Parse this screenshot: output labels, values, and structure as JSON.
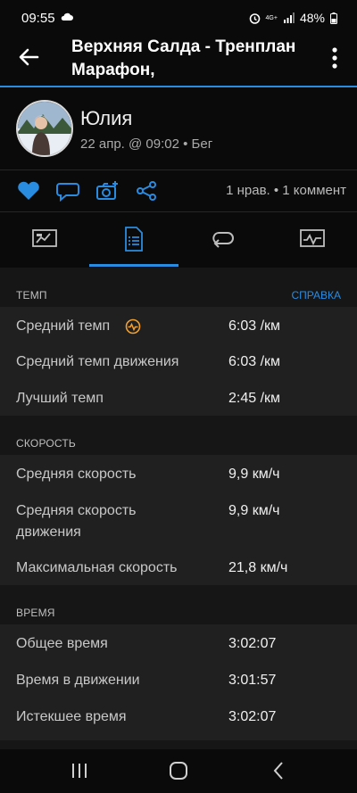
{
  "status_bar": {
    "time": "09:55",
    "network": "4G+",
    "battery": "48%"
  },
  "app_bar": {
    "title": "Верхняя Салда - Трenплан Марафон,"
  },
  "profile": {
    "name": "Юлия",
    "meta": "22 апр. @ 09:02 • Бег"
  },
  "social": {
    "counts": "1 нрав. • 1 коммент"
  },
  "sections": {
    "pace": {
      "title": "ТЕМП",
      "help": "СПРАВКА",
      "rows": [
        {
          "label": "Средний темп",
          "value": "6:03 /км"
        },
        {
          "label": "Средний темп движения",
          "value": "6:03 /км"
        },
        {
          "label": "Лучший темп",
          "value": "2:45 /км"
        }
      ]
    },
    "speed": {
      "title": "СКОРОСТЬ",
      "rows": [
        {
          "label": "Средняя скорость",
          "value": "9,9 км/ч"
        },
        {
          "label": "Средняя скорость",
          "label2": "движения",
          "value": "9,9 км/ч"
        },
        {
          "label": "Максимальная скорость",
          "value": "21,8 км/ч"
        }
      ]
    },
    "time": {
      "title": "ВРЕМЯ",
      "rows": [
        {
          "label": "Общее время",
          "value": "3:02:07"
        },
        {
          "label": "Время в движении",
          "value": "3:01:57"
        },
        {
          "label": "Истекшее время",
          "value": "3:02:07"
        }
      ]
    }
  },
  "colors": {
    "accent": "#2a8ce0",
    "heart": "#2a8ce0",
    "badge": "#f0a030"
  },
  "icons": [
    "arrow-left-icon",
    "more-vert-icon",
    "heart-icon",
    "comment-icon",
    "camera-add-icon",
    "share-icon",
    "overview-tab-icon",
    "stats-tab-icon",
    "laps-tab-icon",
    "charts-tab-icon",
    "pace-badge-icon"
  ]
}
